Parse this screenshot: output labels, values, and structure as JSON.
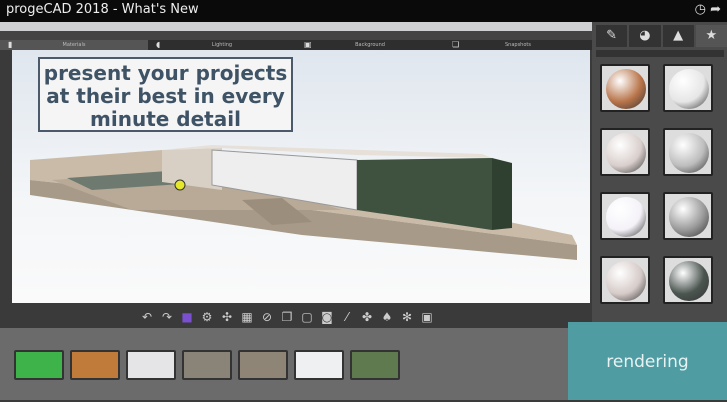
{
  "video": {
    "title": "progeCAD 2018 - What's New",
    "icons": [
      "clock-icon",
      "share-icon"
    ]
  },
  "tabs": [
    {
      "label": "Materials",
      "icon": "materials-icon",
      "active": true
    },
    {
      "label": "Lighting",
      "icon": "lighting-icon"
    },
    {
      "label": "Background",
      "icon": "background-icon"
    },
    {
      "label": "Snapshots",
      "icon": "snapshots-icon"
    }
  ],
  "right_tabs": [
    {
      "icon": "brush-icon",
      "glyph": "✎"
    },
    {
      "icon": "environment-icon",
      "glyph": "◕"
    },
    {
      "icon": "mountain-icon",
      "glyph": "▲"
    },
    {
      "icon": "star-icon",
      "glyph": "★",
      "active": true
    }
  ],
  "caption": {
    "line1": "present your projects",
    "line2": "at their best in every",
    "line3": "minute detail"
  },
  "materials": [
    {
      "color": "#b8744a"
    },
    {
      "color": "#e6e6e6"
    },
    {
      "color": "#d9cfcc"
    },
    {
      "color": "#bdbdbd"
    },
    {
      "color": "#f4f2f8"
    },
    {
      "color": "#9a9a9a"
    },
    {
      "color": "#d6cbc8"
    },
    {
      "color": "#4b5550"
    }
  ],
  "toolbar": [
    {
      "icon": "undo-icon",
      "g": "↶"
    },
    {
      "icon": "redo-icon",
      "g": "↷"
    },
    {
      "icon": "material-paint-icon",
      "g": "■"
    },
    {
      "icon": "render-icon",
      "g": "⚙"
    },
    {
      "icon": "grid-icon",
      "g": "✣"
    },
    {
      "icon": "tiles-icon",
      "g": "▦"
    },
    {
      "icon": "clear-icon",
      "g": "⊘"
    },
    {
      "icon": "copy-icon",
      "g": "❐"
    },
    {
      "icon": "page-icon",
      "g": "▢"
    },
    {
      "icon": "camera-icon",
      "g": "◙"
    },
    {
      "icon": "eyedropper-icon",
      "g": "⁄"
    },
    {
      "icon": "light-icon",
      "g": "✤"
    },
    {
      "icon": "spot-icon",
      "g": "♠"
    },
    {
      "icon": "sun-icon",
      "g": "✻"
    },
    {
      "icon": "snapshot-icon",
      "g": "▣"
    }
  ],
  "thumbnails": [
    {
      "color": "#3db34a"
    },
    {
      "color": "#c07a3a"
    },
    {
      "color": "#e5e5e8"
    },
    {
      "color": "#8a8478"
    },
    {
      "color": "#8f8576"
    },
    {
      "color": "#eef0f2"
    },
    {
      "color": "#5f7a4f"
    }
  ],
  "badge": {
    "text": "rendering",
    "color": "#4f9ca3"
  }
}
